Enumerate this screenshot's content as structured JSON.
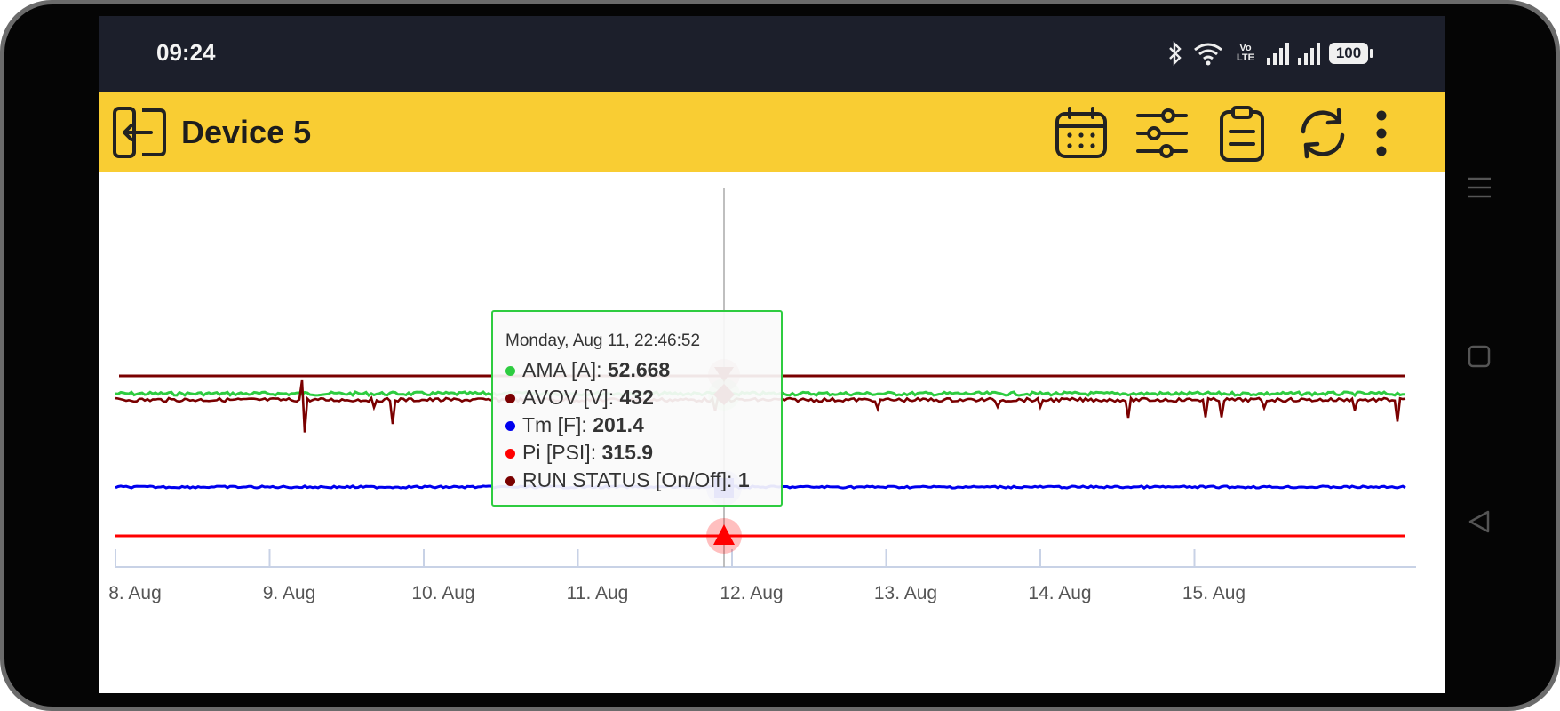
{
  "status_bar": {
    "time": "09:24",
    "battery": "100",
    "network_label": "Vo LTE"
  },
  "app_bar": {
    "title": "Device 5",
    "icons": [
      "exit-icon",
      "calendar-icon",
      "sliders-icon",
      "clipboard-icon",
      "refresh-icon",
      "more-vert-icon"
    ],
    "background": "#f9cd33"
  },
  "tooltip": {
    "date": "Monday, Aug 11, 22:46:52",
    "rows": [
      {
        "label": "AMA [A]: ",
        "value": "52.668",
        "color": "#2ecc40"
      },
      {
        "label": "AVOV [V]: ",
        "value": "432",
        "color": "#7a0000"
      },
      {
        "label": "Tm [F]: ",
        "value": "201.4",
        "color": "#0000ee"
      },
      {
        "label": "Pi [PSI]: ",
        "value": "315.9",
        "color": "#ff0000"
      },
      {
        "label": "RUN STATUS [On/Off]: ",
        "value": "1",
        "color": "#7a0000"
      }
    ]
  },
  "chart_data": {
    "type": "line",
    "x_tick_labels": [
      "8. Aug",
      "9. Aug",
      "10. Aug",
      "11. Aug",
      "12. Aug",
      "13. Aug",
      "14. Aug",
      "15. Aug"
    ],
    "x_range": [
      "8. Aug",
      "15. Aug"
    ],
    "crosshair_x": "Aug 11, 22:46:52",
    "grid": false,
    "legend": "none",
    "series": [
      {
        "name": "AMA [A]",
        "color": "#2ecc40",
        "hover_value": 52.668
      },
      {
        "name": "AVOV [V]",
        "color": "#7a0000",
        "hover_value": 432
      },
      {
        "name": "Tm [F]",
        "color": "#0000ee",
        "hover_value": 201.4
      },
      {
        "name": "Pi [PSI]",
        "color": "#ff0000",
        "hover_value": 315.9
      },
      {
        "name": "RUN STATUS [On/Off]",
        "color": "#7a0000",
        "hover_value": 1
      }
    ]
  }
}
